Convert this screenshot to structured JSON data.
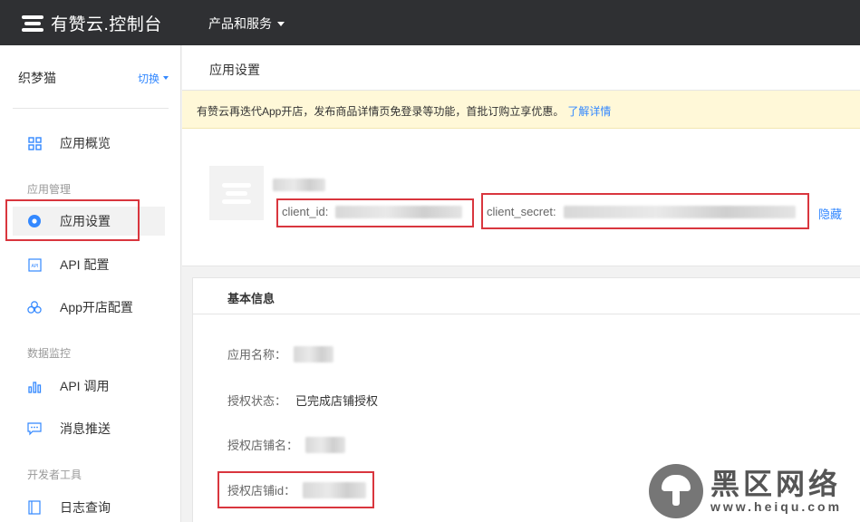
{
  "topbar": {
    "logo_text": "有赞云.控制台",
    "nav_products": "产品和服务"
  },
  "sidebar": {
    "shop_name": "织梦猫",
    "switch_label": "切换",
    "groups": {
      "app_manage": "应用管理",
      "data_monitor": "数据监控",
      "dev_tools": "开发者工具"
    },
    "items": [
      {
        "label": "应用概览",
        "icon": "grid-icon"
      },
      {
        "label": "应用设置",
        "icon": "settings-dot-icon",
        "active": true
      },
      {
        "label": "API 配置",
        "icon": "api-doc-icon"
      },
      {
        "label": "App开店配置",
        "icon": "three-circles-icon"
      },
      {
        "label": "API 调用",
        "icon": "bar-chart-icon"
      },
      {
        "label": "消息推送",
        "icon": "chat-bubble-icon"
      },
      {
        "label": "日志查询",
        "icon": "book-icon"
      }
    ]
  },
  "main": {
    "title": "应用设置",
    "notice": {
      "text": "有赞云再迭代App开店，发布商品详情页免登录等功能，首批订购立享优惠。",
      "link": "了解详情"
    },
    "app": {
      "client_id_label": "client_id:",
      "client_secret_label": "client_secret:",
      "hide_label": "隐藏"
    },
    "basic_info": {
      "title": "基本信息",
      "rows": [
        {
          "label": "应用名称："
        },
        {
          "label": "授权状态：",
          "value": "已完成店铺授权"
        },
        {
          "label": "授权店铺名："
        },
        {
          "label": "授权店铺id："
        }
      ]
    }
  },
  "watermark": {
    "cn": "黑区网络",
    "url": "www.heiqu.com"
  },
  "colors": {
    "topbar": "#2f3033",
    "accent": "#3388ff",
    "highlight": "#d9363e",
    "notice_bg": "#fff8d8"
  }
}
